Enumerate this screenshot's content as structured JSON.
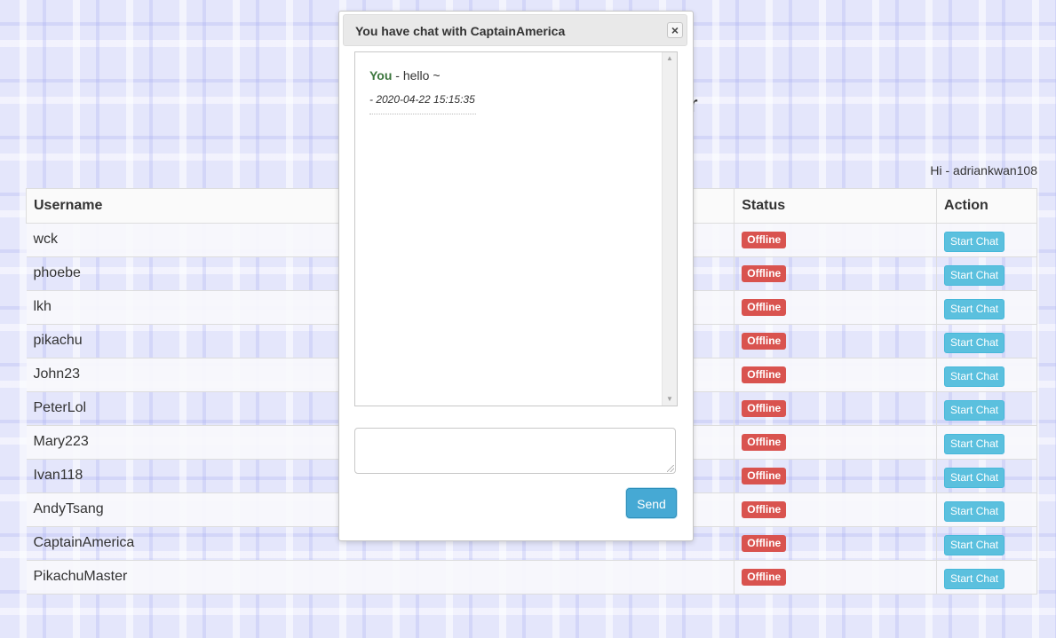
{
  "page": {
    "heading_fragment": "r",
    "greeting": "Hi - adriankwan108"
  },
  "table": {
    "headers": {
      "username": "Username",
      "status": "Status",
      "action": "Action"
    },
    "rows": [
      {
        "username": "wck",
        "status": "Offline",
        "action": "Start Chat"
      },
      {
        "username": "phoebe",
        "status": "Offline",
        "action": "Start Chat"
      },
      {
        "username": "lkh",
        "status": "Offline",
        "action": "Start Chat"
      },
      {
        "username": "pikachu",
        "status": "Offline",
        "action": "Start Chat"
      },
      {
        "username": "John23",
        "status": "Offline",
        "action": "Start Chat"
      },
      {
        "username": "PeterLol",
        "status": "Offline",
        "action": "Start Chat"
      },
      {
        "username": "Mary223",
        "status": "Offline",
        "action": "Start Chat"
      },
      {
        "username": "Ivan118",
        "status": "Offline",
        "action": "Start Chat"
      },
      {
        "username": "AndyTsang",
        "status": "Offline",
        "action": "Start Chat"
      },
      {
        "username": "CaptainAmerica",
        "status": "Offline",
        "action": "Start Chat"
      },
      {
        "username": "PikachuMaster",
        "status": "Offline",
        "action": "Start Chat"
      }
    ]
  },
  "chat_dialog": {
    "title": "You have chat with CaptainAmerica",
    "close_icon": "close-icon",
    "close_glyph": "×",
    "messages": [
      {
        "sender": "You",
        "separator": " - ",
        "text": "hello ~",
        "timestamp": "- 2020-04-22 15:15:35"
      }
    ],
    "input_value": "",
    "send_label": "Send"
  },
  "colors": {
    "offline_badge": "#d9534f",
    "start_chat_button": "#5bc0de",
    "send_button": "#46a9d4",
    "sender_name": "#3c763d"
  }
}
